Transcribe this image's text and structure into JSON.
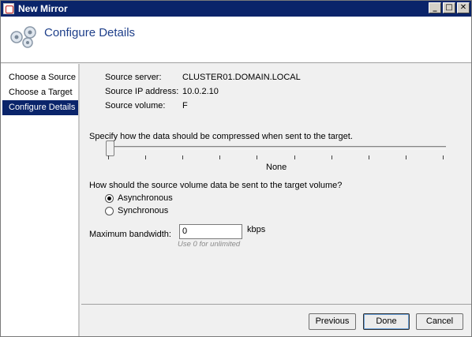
{
  "window": {
    "title": "New Mirror",
    "controls": {
      "minimize": "_",
      "maximize": "□",
      "close": "✕"
    }
  },
  "header": {
    "title": "Configure Details",
    "icon": "mirror-wizard-icon"
  },
  "nav": {
    "items": [
      {
        "label": "Choose a Source",
        "active": false
      },
      {
        "label": "Choose a Target",
        "active": false
      },
      {
        "label": "Configure Details",
        "active": true
      }
    ]
  },
  "source": {
    "server_label": "Source server:",
    "server_value": "CLUSTER01.DOMAIN.LOCAL",
    "ip_label": "Source IP address:",
    "ip_value": "10.0.2.10",
    "volume_label": "Source volume:",
    "volume_value": "F"
  },
  "compression": {
    "label": "Specify how the data should be compressed when sent to the target.",
    "level_text": "None",
    "level_index": 0,
    "tick_count": 10
  },
  "transfer": {
    "label": "How should the source volume data be sent to the target volume?",
    "options": [
      {
        "label": "Asynchronous",
        "selected": true
      },
      {
        "label": "Synchronous",
        "selected": false
      }
    ]
  },
  "bandwidth": {
    "label": "Maximum bandwidth:",
    "value": "0",
    "unit": "kbps",
    "hint": "Use 0 for unlimited"
  },
  "footer": {
    "previous": "Previous",
    "done": "Done",
    "cancel": "Cancel"
  }
}
